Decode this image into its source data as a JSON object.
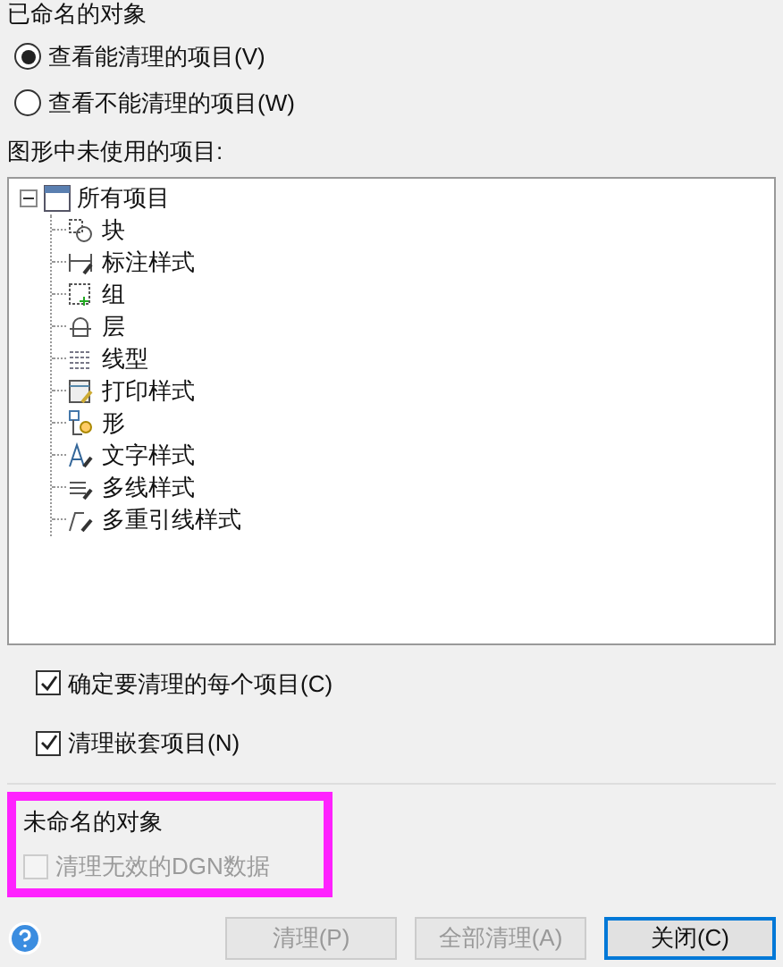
{
  "named_objects": {
    "title": "已命名的对象",
    "view_options": [
      {
        "label": "查看能清理的项目(V)",
        "selected": true
      },
      {
        "label": "查看不能清理的项目(W)",
        "selected": false
      }
    ],
    "tree_label": "图形中未使用的项目:",
    "tree": {
      "label": "所有项目",
      "expanded": true,
      "children": [
        {
          "label": "块",
          "kind": "block"
        },
        {
          "label": "标注样式",
          "kind": "dimstyle"
        },
        {
          "label": "组",
          "kind": "group"
        },
        {
          "label": "层",
          "kind": "layer"
        },
        {
          "label": "线型",
          "kind": "linetype"
        },
        {
          "label": "打印样式",
          "kind": "plotstyle"
        },
        {
          "label": "形",
          "kind": "shape"
        },
        {
          "label": "文字样式",
          "kind": "textstyle"
        },
        {
          "label": "多线样式",
          "kind": "mlinestyle"
        },
        {
          "label": "多重引线样式",
          "kind": "mleaderstyle"
        }
      ]
    },
    "options": [
      {
        "label": "确定要清理的每个项目(C)",
        "checked": true
      },
      {
        "label": "清理嵌套项目(N)",
        "checked": true
      }
    ]
  },
  "unnamed_objects": {
    "title": "未命名的对象",
    "highlighted": true,
    "options": [
      {
        "label": "清理无效的DGN数据",
        "checked": false,
        "disabled": true
      }
    ]
  },
  "buttons": [
    {
      "label": "清理(P)",
      "disabled": true,
      "default": false
    },
    {
      "label": "全部清理(A)",
      "disabled": true,
      "default": false
    },
    {
      "label": "关闭(C)",
      "disabled": false,
      "default": true
    }
  ]
}
